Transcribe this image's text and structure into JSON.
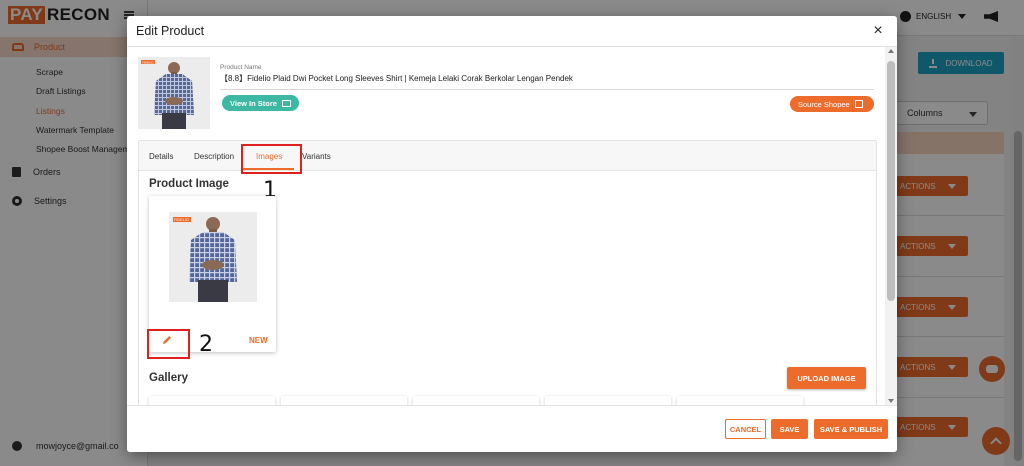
{
  "colors": {
    "accent": "#ee6c2b",
    "teal": "#3db8a3",
    "download": "#1aa3c4",
    "callout": "#e02020"
  },
  "app": {
    "logo_pay": "PAY",
    "logo_recon": "RECON",
    "language": "ENGLISH",
    "download_label": "DOWNLOAD",
    "columns_label": "Columns",
    "actions_label": "ACTIONS",
    "user_email": "mowjoyce@gmail.co"
  },
  "sidebar": {
    "product": "Product",
    "sub_items": [
      "Scrape",
      "Draft Listings",
      "Listings",
      "Watermark Template",
      "Shopee Boost Managem"
    ],
    "active_sub": "Listings",
    "orders": "Orders",
    "settings": "Settings"
  },
  "modal": {
    "title": "Edit Product",
    "close": "×",
    "product_name_label": "Product Name",
    "product_name": "【8.8】Fidelio Plaid Dwi Pocket Long Sleeves Shirt | Kemeja Lelaki Corak Berkolar Lengan Pendek",
    "view_in_store": "View In Store",
    "source_shopee": "Source Shopee",
    "tabs": [
      "Details",
      "Description",
      "Images",
      "Variants"
    ],
    "active_tab": "Images",
    "product_image_title": "Product Image",
    "new_badge": "NEW",
    "gallery_title": "Gallery",
    "upload_image": "UPLOAD IMAGE",
    "cancel": "CANCEL",
    "save": "SAVE",
    "save_publish": "SAVE & PUBLISH",
    "brand_mark": "FIDELIO"
  },
  "annotations": {
    "callout_1": "1",
    "callout_2": "2"
  }
}
